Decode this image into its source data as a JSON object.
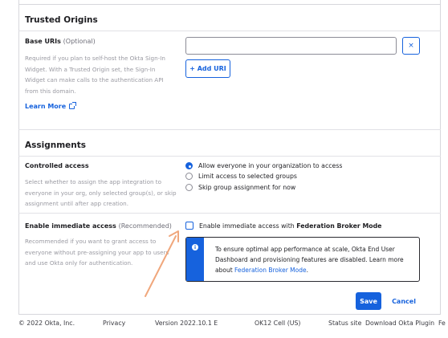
{
  "trusted_origins": {
    "title": "Trusted Origins",
    "base_uris_label": "Base URIs",
    "base_uris_optional": "(Optional)",
    "help": "Required if you plan to self-host the Okta Sign-In Widget. With a Trusted Origin set, the Sign-In Widget can make calls to the authentication API from this domain.",
    "learn_more": "Learn More",
    "input_value": "",
    "clear_label": "×",
    "add_uri_label": "+ Add URI"
  },
  "assignments": {
    "title": "Assignments",
    "controlled_access_label": "Controlled access",
    "controlled_access_help": "Select whether to assign the app integration to everyone in your org, only selected group(s), or skip assignment until after app creation.",
    "radio_options": [
      "Allow everyone in your organization to access",
      "Limit access to selected groups",
      "Skip group assignment for now"
    ],
    "immediate_access_label": "Enable immediate access",
    "immediate_access_recommended": "(Recommended)",
    "immediate_access_help": "Recommended if you want to grant access to everyone without pre-assigning your app to users and use Okta only for authentication.",
    "checkbox_text_prefix": "Enable immediate access with ",
    "checkbox_text_bold": "Federation Broker Mode",
    "callout_text": "To ensure optimal app performance at scale, Okta End User Dashboard and provisioning features are disabled. Learn more about ",
    "callout_link": "Federation Broker Mode",
    "callout_period": ".",
    "info_icon_glyph": "i"
  },
  "actions": {
    "save_label": "Save",
    "cancel_label": "Cancel"
  },
  "footer": {
    "copyright": "© 2022 Okta, Inc.",
    "privacy": "Privacy",
    "version": "Version 2022.10.1 E",
    "cell": "OK12 Cell (US)",
    "status": "Status site",
    "download": "Download Okta Plugin",
    "truncated": "Fe"
  },
  "colors": {
    "accent": "#1662dd",
    "annotation_arrow": "#f0a77c"
  }
}
